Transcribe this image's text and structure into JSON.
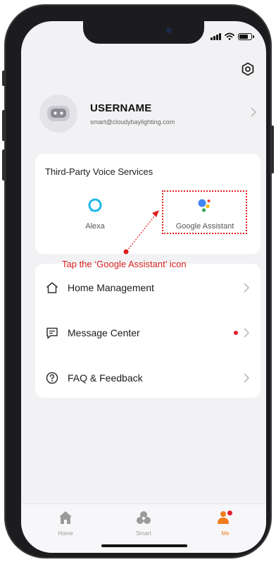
{
  "status_bar": {
    "signal": "signal-icon",
    "wifi": "wifi-icon",
    "battery": "battery-icon"
  },
  "header": {
    "settings_icon": "gear-icon"
  },
  "profile": {
    "username": "USERNAME",
    "email": "smart@cloudybaylighting.com",
    "avatar_icon": "robot-face-icon"
  },
  "voice_services": {
    "title": "Third-Party Voice Services",
    "items": [
      {
        "label": "Alexa",
        "icon": "alexa-icon",
        "color": "#1fb7e8"
      },
      {
        "label": "Google Assistant",
        "icon": "google-assistant-icon"
      }
    ]
  },
  "annotation": {
    "text": "Tap the ‘Google Assistant’ icon",
    "color": "#d42020"
  },
  "menu": {
    "items": [
      {
        "label": "Home Management",
        "icon": "house-icon"
      },
      {
        "label": "Message Center",
        "icon": "message-icon",
        "has_badge": true
      },
      {
        "label": "FAQ & Feedback",
        "icon": "question-icon"
      }
    ]
  },
  "tabbar": {
    "tabs": [
      {
        "label": "Home",
        "icon": "home-icon"
      },
      {
        "label": "Smart",
        "icon": "smart-icon"
      },
      {
        "label": "Me",
        "icon": "person-icon",
        "active": true
      }
    ],
    "active_color": "#f07c1c"
  }
}
